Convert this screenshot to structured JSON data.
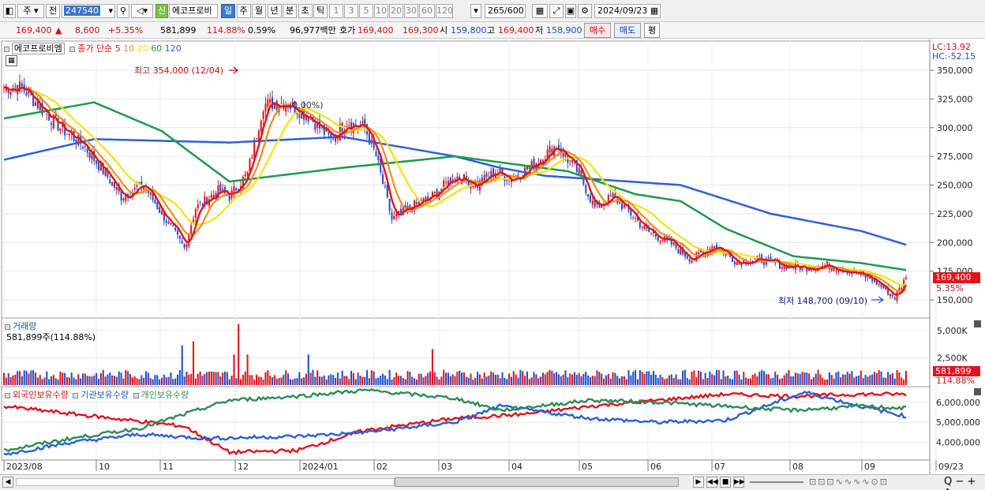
{
  "toolbar": {
    "period_type": "주",
    "prev_label": "전",
    "code": "247540",
    "search_icon": "magnifier-icon",
    "sound_icon": "speaker-icon",
    "new_badge": "신",
    "stock_name": "에코프로비",
    "period_tabs": [
      "일",
      "주",
      "월",
      "년",
      "분",
      "초",
      "틱"
    ],
    "selected_period": "일",
    "interval_buttons": [
      "1",
      "3",
      "5",
      "10",
      "20",
      "30",
      "60",
      "120"
    ],
    "count_display": "265",
    "count_total": "/600",
    "date": "2024/09/23"
  },
  "infobar": {
    "price": "169,400",
    "change": "8,600",
    "change_pct": "+5.35%",
    "volume": "581,899",
    "volume_ratio": "114.88%",
    "turnover": "0.59%",
    "amount": "96,977백만",
    "quote_label": "호가",
    "ask": "169,400",
    "bid": "169,300",
    "open_label": "시",
    "open": "159,800",
    "high_label": "고",
    "high": "169,400",
    "low_label": "저",
    "low": "158,900",
    "buy_label": "매수",
    "sell_label": "매도",
    "eval_label": "평"
  },
  "price_pane": {
    "stock_label": "에코프로비엠",
    "ma_label": "종가 단순",
    "ma_periods": [
      "5",
      "10",
      "20",
      "60",
      "120"
    ],
    "ma_colors": [
      "#e0141c",
      "#f28c1c",
      "#f5e20a",
      "#1c9a4a",
      "#2c5fd8"
    ],
    "lc": "LC:13.92",
    "hc": "HC:-52.15",
    "max_annotation": "최고 354,000 (12/04)",
    "min_annotation": "최저 148,700 (09/10)",
    "overlay_text": "(0.00%)",
    "current_price_tag": "169,400",
    "current_pct_tag": "5.35%",
    "y_ticks": [
      "350,000",
      "325,000",
      "300,000",
      "275,000",
      "250,000",
      "225,000",
      "200,000",
      "175,000",
      "150,000"
    ]
  },
  "volume_pane": {
    "title": "거래량",
    "subtitle": "581,899주(114.88%)",
    "y_ticks": [
      "5,000K",
      "2,500K"
    ],
    "current_tag": "581,899",
    "current_pct_tag": "114.88%"
  },
  "holdings_pane": {
    "series_labels": [
      "외국인보유수량",
      "기관보유수량",
      "개인보유수량"
    ],
    "series_colors": [
      "#e0141c",
      "#2c5fd8",
      "#2e8b57"
    ],
    "y_ticks": [
      "6,000,000",
      "5,000,000",
      "4,000,000"
    ]
  },
  "x_axis": {
    "labels": [
      "2023/08",
      "10",
      "11",
      "12",
      "2024/01",
      "02",
      "03",
      "04",
      "05",
      "06",
      "07",
      "08",
      "09",
      "09/23"
    ]
  },
  "chart_data": {
    "type": "line",
    "title": "에코프로비엠",
    "ylim": [
      140000,
      360000
    ],
    "x_labels": [
      "2023/08",
      "10",
      "11",
      "12",
      "2024/01",
      "02",
      "03",
      "04",
      "05",
      "06",
      "07",
      "08",
      "09"
    ],
    "price_keypoints": {
      "index": [
        0,
        8,
        15,
        25,
        35,
        45,
        52,
        62,
        70,
        80,
        85,
        95,
        100,
        108,
        115,
        125,
        135,
        145,
        152,
        160,
        165,
        172,
        180,
        190,
        200,
        210,
        218,
        225,
        235,
        245,
        255,
        262,
        270,
        278,
        285,
        295,
        305,
        315,
        325,
        335,
        345,
        355,
        365,
        375,
        385,
        395,
        400
      ],
      "close": [
        335000,
        335000,
        320000,
        300000,
        285000,
        260000,
        240000,
        250000,
        225000,
        195000,
        230000,
        245000,
        240000,
        260000,
        320000,
        322000,
        310000,
        290000,
        305000,
        300000,
        275000,
        220000,
        230000,
        240000,
        258000,
        250000,
        262000,
        255000,
        268000,
        285000,
        260000,
        230000,
        240000,
        225000,
        210000,
        200000,
        185000,
        198000,
        183000,
        185000,
        180000,
        178000,
        180000,
        175000,
        168000,
        152000,
        169400
      ]
    },
    "ma_series": [
      "MA5",
      "MA10",
      "MA20",
      "MA60",
      "MA120"
    ],
    "ma120_keypoints": {
      "index": [
        0,
        40,
        100,
        150,
        200,
        220,
        240,
        300,
        340,
        380,
        400
      ],
      "value": [
        272000,
        290000,
        287000,
        292000,
        275000,
        265000,
        258000,
        250000,
        225000,
        210000,
        198000
      ]
    },
    "ma60_keypoints": {
      "index": [
        0,
        40,
        70,
        100,
        150,
        200,
        250,
        280,
        300,
        320,
        350,
        380,
        400
      ],
      "value": [
        308000,
        322000,
        297000,
        253000,
        265000,
        275000,
        262000,
        242000,
        236000,
        212000,
        188000,
        182000,
        176000
      ]
    },
    "holdings": {
      "series": [
        {
          "name": "외국인보유수량",
          "index": [
            0,
            40,
            80,
            100,
            130,
            160,
            200,
            230,
            260,
            290,
            320,
            350,
            380,
            400
          ],
          "value": [
            5800000,
            5300000,
            4800000,
            3500000,
            3600000,
            4600000,
            5200000,
            5400000,
            5800000,
            6100000,
            6400000,
            6300000,
            6400000,
            6400000
          ]
        },
        {
          "name": "기관보유수량",
          "index": [
            0,
            30,
            60,
            90,
            130,
            160,
            200,
            220,
            260,
            290,
            320,
            340,
            355,
            380,
            400
          ],
          "value": [
            3400000,
            4000000,
            4400000,
            4200000,
            4300000,
            4500000,
            5000000,
            5800000,
            5200000,
            5000000,
            5100000,
            5900000,
            6500000,
            5800000,
            5300000
          ]
        },
        {
          "name": "개인보유수량",
          "index": [
            0,
            30,
            60,
            100,
            130,
            160,
            200,
            220,
            260,
            290,
            320,
            350,
            380,
            400
          ],
          "value": [
            3600000,
            4200000,
            4700000,
            6100000,
            6300000,
            6600000,
            6200000,
            5600000,
            6100000,
            6000000,
            5800000,
            5600000,
            5800000,
            5700000
          ]
        }
      ]
    }
  }
}
